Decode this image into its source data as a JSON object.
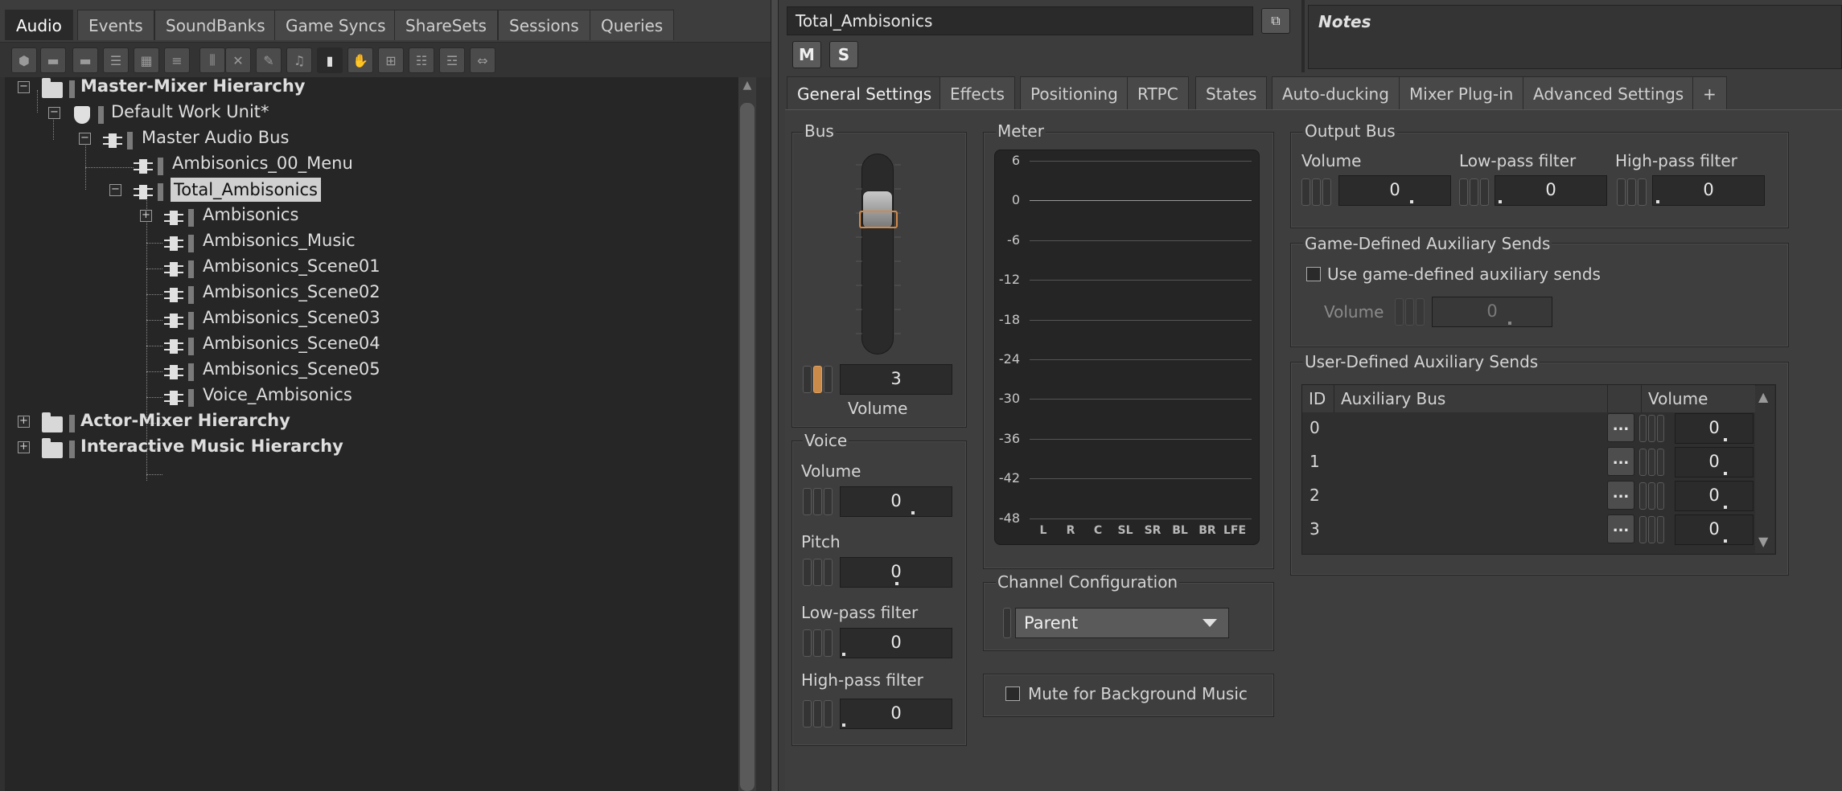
{
  "left_tabs": [
    {
      "label": "Audio"
    },
    {
      "label": "Events"
    },
    {
      "label": "SoundBanks"
    },
    {
      "label": "Game Syncs"
    },
    {
      "label": "ShareSets"
    },
    {
      "label": "Sessions"
    },
    {
      "label": "Queries"
    }
  ],
  "toolbar_icons": [
    "work-unit-icon",
    "folder-icon",
    "folder-icon",
    "actor-mixer-icon",
    "grid-icon",
    "list-icon",
    "sequence-icon",
    "random-icon",
    "blend-icon",
    "music-icon",
    "bus-icon",
    "aux-bus-icon",
    "switch-icon",
    "playlist-icon",
    "segment-icon",
    "track-icon"
  ],
  "tree": {
    "items": [
      {
        "label": "Master-Mixer Hierarchy"
      },
      {
        "label": "Default Work Unit*"
      },
      {
        "label": "Master Audio Bus"
      },
      {
        "label": "Ambisonics_00_Menu"
      },
      {
        "label": "Total_Ambisonics"
      },
      {
        "label": "Ambisonics"
      },
      {
        "label": "Ambisonics_Music"
      },
      {
        "label": "Ambisonics_Scene01"
      },
      {
        "label": "Ambisonics_Scene02"
      },
      {
        "label": "Ambisonics_Scene03"
      },
      {
        "label": "Ambisonics_Scene04"
      },
      {
        "label": "Ambisonics_Scene05"
      },
      {
        "label": "Voice_Ambisonics"
      },
      {
        "label": "Actor-Mixer Hierarchy"
      },
      {
        "label": "Interactive Music Hierarchy"
      }
    ]
  },
  "header": {
    "object_name": "Total_Ambisonics",
    "mute_label": "M",
    "solo_label": "S",
    "notes_label": "Notes"
  },
  "right_tabs": [
    {
      "label": "General Settings"
    },
    {
      "label": "Effects"
    },
    {
      "label": "Positioning"
    },
    {
      "label": "RTPC"
    },
    {
      "label": "States"
    },
    {
      "label": "Auto-ducking"
    },
    {
      "label": "Mixer Plug-in"
    },
    {
      "label": "Advanced Settings"
    },
    {
      "label": "+"
    }
  ],
  "bus": {
    "group_label": "Bus",
    "volume_value": "3",
    "volume_label": "Volume"
  },
  "voice": {
    "group_label": "Voice",
    "volume_label": "Volume",
    "volume_value": "0",
    "pitch_label": "Pitch",
    "pitch_value": "0",
    "lpf_label": "Low-pass filter",
    "lpf_value": "0",
    "hpf_label": "High-pass filter",
    "hpf_value": "0"
  },
  "meter": {
    "group_label": "Meter",
    "ticks": [
      "6",
      "0",
      "-6",
      "-12",
      "-18",
      "-24",
      "-30",
      "-36",
      "-42",
      "-48"
    ],
    "channels": [
      "L",
      "R",
      "C",
      "SL",
      "SR",
      "BL",
      "BR",
      "LFE"
    ]
  },
  "channel_config": {
    "group_label": "Channel Configuration",
    "selected": "Parent"
  },
  "mute_bg": {
    "label": "Mute for Background Music",
    "checked": false
  },
  "output_bus": {
    "group_label": "Output Bus",
    "volume_label": "Volume",
    "volume_value": "0",
    "lpf_label": "Low-pass filter",
    "lpf_value": "0",
    "hpf_label": "High-pass filter",
    "hpf_value": "0"
  },
  "game_aux": {
    "group_label": "Game-Defined Auxiliary Sends",
    "checkbox_label": "Use game-defined auxiliary sends",
    "checked": false,
    "volume_label": "Volume",
    "volume_value": "0"
  },
  "user_aux": {
    "group_label": "User-Defined Auxiliary Sends",
    "columns": [
      "ID",
      "Auxiliary Bus",
      "",
      "Volume"
    ],
    "rows": [
      {
        "id": "0",
        "bus": "",
        "button": "...",
        "volume": "0"
      },
      {
        "id": "1",
        "bus": "",
        "button": "...",
        "volume": "0"
      },
      {
        "id": "2",
        "bus": "",
        "button": "...",
        "volume": "0"
      },
      {
        "id": "3",
        "bus": "",
        "button": "...",
        "volume": "0"
      }
    ]
  },
  "colors": {
    "accent_orange": "#d08a4a",
    "background": "#3c3c3c",
    "tree_background": "#262626"
  }
}
